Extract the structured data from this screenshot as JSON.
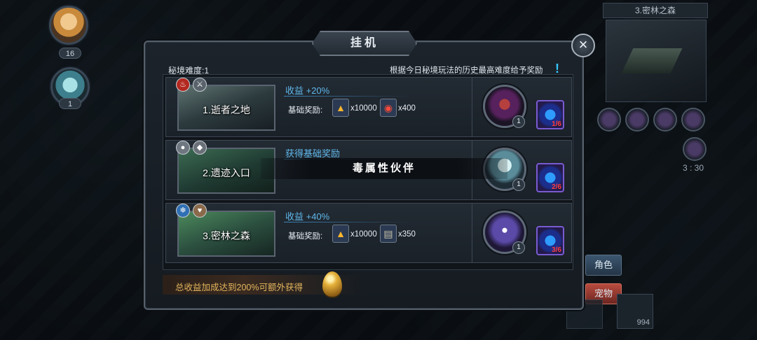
{
  "left_heroes": [
    {
      "level": "16"
    },
    {
      "level": "1"
    }
  ],
  "minimap": {
    "title": "3.密林之森"
  },
  "timer": "3 : 30",
  "side_tabs": {
    "role": "角色",
    "pet": "宠物"
  },
  "inventory": {
    "count": "994"
  },
  "panel": {
    "title": "挂机",
    "close": "×",
    "difficulty": "秘境难度:1",
    "notice": "根据今日秘境玩法的历史最高难度给予奖励",
    "notice_mark": "!",
    "footer": "总收益加成达到200%可额外获得"
  },
  "rows": [
    {
      "name": "1.逝者之地",
      "bonus": "收益 +20%",
      "base_label": "基础奖励:",
      "reward_a": "x10000",
      "reward_b": "x400",
      "pet_level": "1",
      "crystal": "1/6"
    },
    {
      "name": "2.遗迹入口",
      "bonus": "获得基础奖励",
      "base_label": "",
      "reward_a": "",
      "reward_b": "",
      "pet_level": "1",
      "crystal": "2/6"
    },
    {
      "name": "3.密林之森",
      "bonus": "收益 +40%",
      "base_label": "基础奖励:",
      "reward_a": "x10000",
      "reward_b": "x350",
      "pet_level": "1",
      "crystal": "3/6"
    }
  ],
  "tooltip": "毒属性伙伴",
  "icons": {
    "row1_attrs": [
      "fire-icon",
      "sword-icon"
    ],
    "row2_attrs": [
      "drop-icon",
      "shield-icon"
    ],
    "row3_attrs": [
      "snowflake-icon",
      "heart-icon"
    ],
    "reward_a_icon": "upgrade-arrow-icon",
    "reward_b_icon_row1": "red-gem-icon",
    "reward_b_icon_row3": "scroll-icon",
    "crystal_icon": "blue-crystal-icon",
    "footer_icon": "golden-egg-icon"
  },
  "colors": {
    "bonus_text": "#5fb7ea",
    "footer_text": "#e5b75d",
    "crystal_count": "#ff3c3c",
    "pet_tab": "#b84b3e",
    "role_tab": "#3c5670"
  }
}
